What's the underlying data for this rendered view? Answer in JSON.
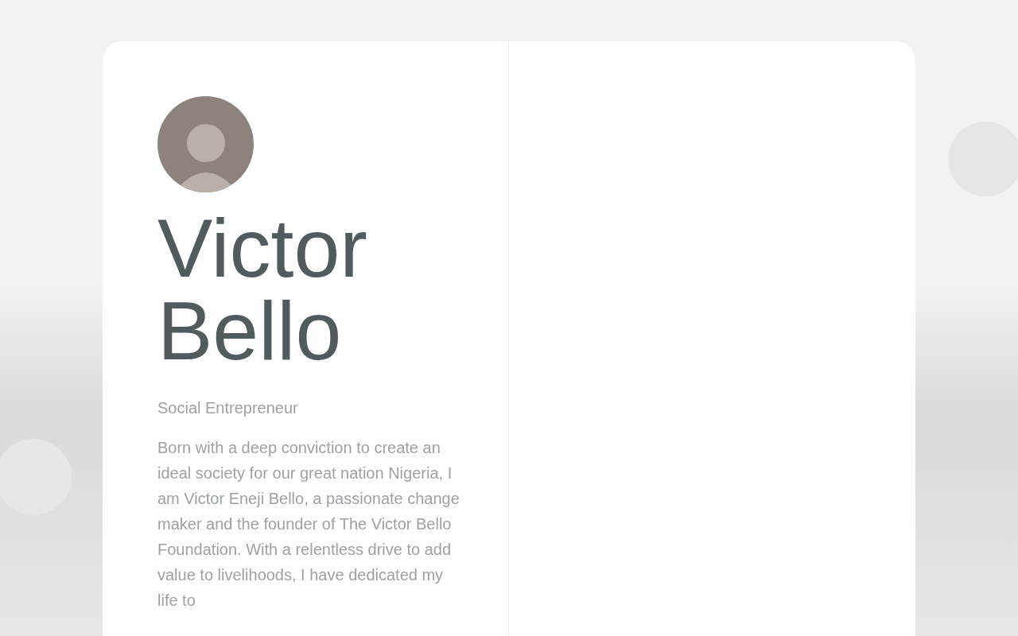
{
  "profile": {
    "name": "Victor Bello",
    "role": "Social Entrepreneur",
    "bio": "Born with a deep conviction to create an ideal society for our great nation Nigeria, I am Victor Eneji Bello, a passionate change maker and the founder of The Victor Bello Foundation. With a relentless drive to add value to livelihoods, I have dedicated my life to"
  }
}
